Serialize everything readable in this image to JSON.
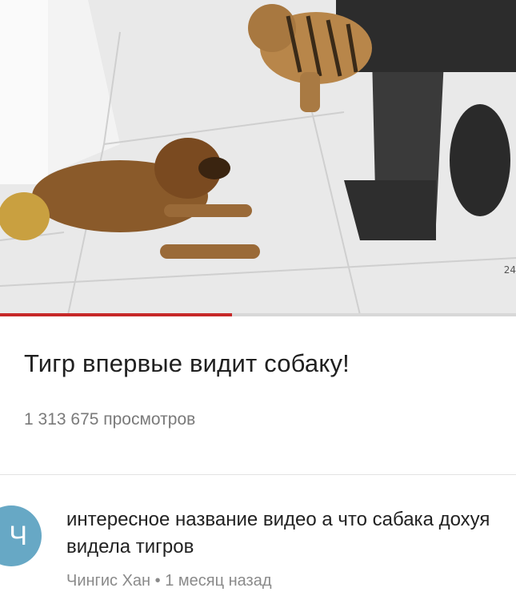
{
  "video": {
    "title": "Тигр впервые видит собаку!",
    "views": "1 313 675 просмотров",
    "channel_badge": "24",
    "progress": 0.45
  },
  "comment": {
    "avatar_letter": "Ч",
    "text": "интересное название видео а что сабака дохуя видела тигров",
    "author": "Чингис Хан",
    "separator": "•",
    "time": "1 месяц назад"
  },
  "colors": {
    "progress_fill": "#c62828",
    "avatar_bg": "#67a8c5"
  }
}
